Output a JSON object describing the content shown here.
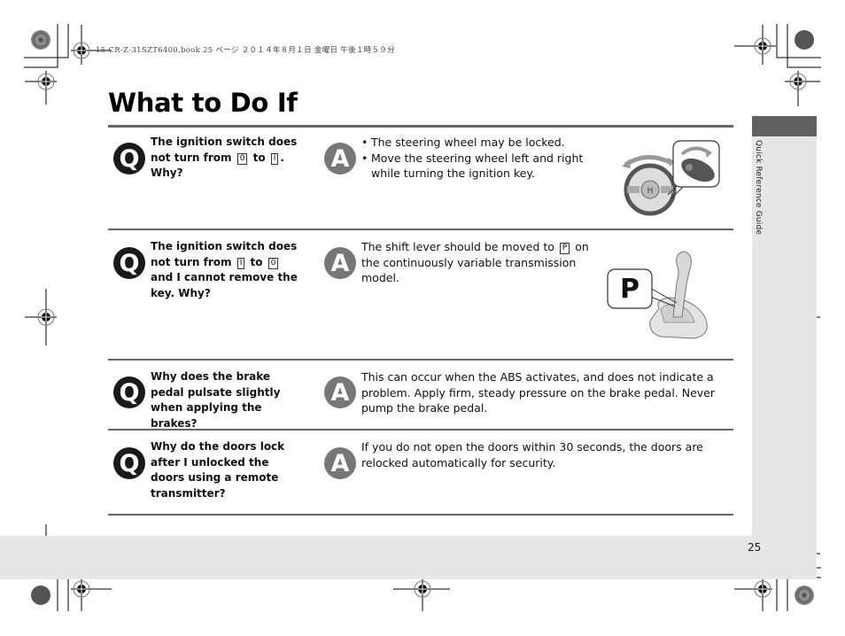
{
  "print_header": "15 CR-Z-31SZT6400.book  25 ページ  ２０１４年８月１日  金曜日  午後１時５９分",
  "page": {
    "title": "What to Do If",
    "section_tab": "Quick Reference Guide",
    "number": "25"
  },
  "badges": {
    "question": "Q",
    "answer": "A"
  },
  "items": [
    {
      "question": {
        "parts": [
          "The ignition switch does not turn from ",
          "0",
          " to ",
          "I",
          ". Why?"
        ]
      },
      "answer": {
        "bullets": [
          "The steering wheel may be locked.",
          "Move the steering wheel left and right while turning the ignition key."
        ]
      },
      "illustration": "steering-wheel-ignition-key"
    },
    {
      "question": {
        "parts": [
          "The ignition switch does not turn from ",
          "I",
          " to ",
          "0",
          " and I cannot remove the key. Why?"
        ]
      },
      "answer": {
        "parts": [
          "The shift lever should be moved to ",
          "P",
          " on the continuously variable transmission model."
        ]
      },
      "illustration": "shift-lever-park",
      "illustration_label": "P"
    },
    {
      "question": {
        "text": "Why does the brake pedal pulsate slightly when applying the brakes?"
      },
      "answer": {
        "text": "This can occur when the ABS activates, and does not indicate a problem. Apply firm, steady pressure on the brake pedal. Never pump the brake pedal."
      }
    },
    {
      "question": {
        "text": "Why do the doors lock after I unlocked the doors using a remote transmitter?"
      },
      "answer": {
        "text": "If you do not open the doors within 30 seconds, the doors are relocked automatically for security."
      }
    }
  ]
}
